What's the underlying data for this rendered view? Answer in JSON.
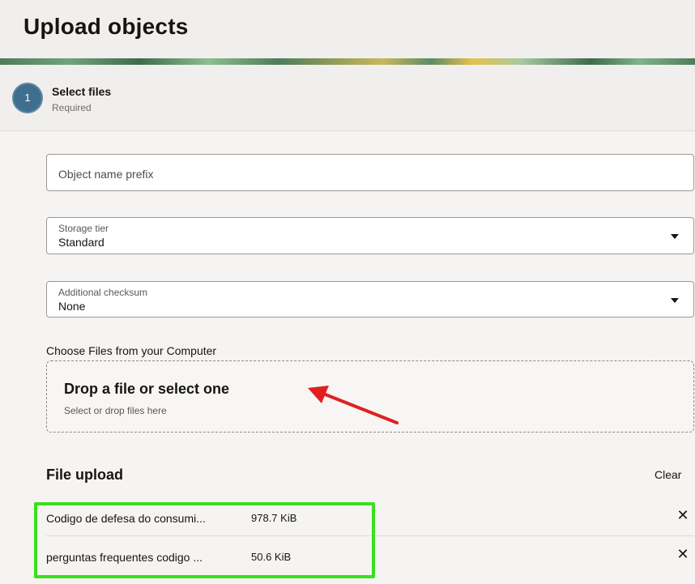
{
  "header": {
    "title": "Upload objects"
  },
  "step": {
    "number": "1",
    "title": "Select files",
    "subtitle": "Required"
  },
  "form": {
    "prefix_placeholder": "Object name prefix",
    "storage_tier": {
      "label": "Storage tier",
      "value": "Standard"
    },
    "checksum": {
      "label": "Additional checksum",
      "value": "None"
    }
  },
  "dropzone": {
    "section_label": "Choose Files from your Computer",
    "title": "Drop a file or select one",
    "subtitle": "Select or drop files here"
  },
  "file_upload": {
    "title": "File upload",
    "clear_label": "Clear",
    "remove_icon": "close-icon",
    "files": [
      {
        "name": "Codigo de defesa do consumi...",
        "size": "978.7 KiB"
      },
      {
        "name": "perguntas frequentes codigo ...",
        "size": "50.6 KiB"
      }
    ]
  },
  "annotations": {
    "arrow_color": "#e02020",
    "highlight_color": "#39e01c"
  }
}
